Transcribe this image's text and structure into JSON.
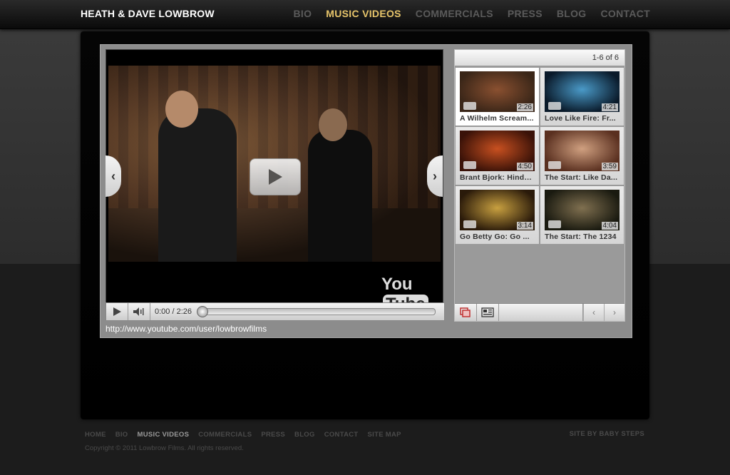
{
  "header": {
    "brand": "HEATH & DAVE LOWBROW",
    "nav": [
      {
        "label": "BIO",
        "active": false
      },
      {
        "label": "MUSIC VIDEOS",
        "active": true
      },
      {
        "label": "COMMERCIALS",
        "active": false
      },
      {
        "label": "PRESS",
        "active": false
      },
      {
        "label": "BLOG",
        "active": false
      },
      {
        "label": "CONTACT",
        "active": false
      }
    ]
  },
  "player": {
    "logo_you": "You",
    "logo_tube": "Tube",
    "time": "0:00 / 2:26",
    "progress": 0,
    "channel_url": "http://www.youtube.com/user/lowbrowfilms",
    "icons": [
      "play-icon",
      "volume-icon",
      "chevron-left-icon",
      "chevron-right-icon"
    ]
  },
  "playlist": {
    "count": "1-6 of 6",
    "items": [
      {
        "title": "A Wilhelm Scream...",
        "duration": "2:26",
        "selected": true,
        "colors": [
          "#3a2618",
          "#8a5030"
        ]
      },
      {
        "title": "Love Like Fire: Fr...",
        "duration": "4:21",
        "selected": false,
        "colors": [
          "#0a1a2a",
          "#4a9ac8"
        ]
      },
      {
        "title": "Brant Bjork: Hinda...",
        "duration": "4:50",
        "selected": false,
        "colors": [
          "#3a1208",
          "#c85020"
        ]
      },
      {
        "title": "The Start: Like Da...",
        "duration": "3:59",
        "selected": false,
        "colors": [
          "#5a3020",
          "#d0a080"
        ]
      },
      {
        "title": "Go Betty Go: Go ...",
        "duration": "3:14",
        "selected": false,
        "colors": [
          "#2a1a0a",
          "#c8a040"
        ]
      },
      {
        "title": "The Start: The 1234",
        "duration": "4:04",
        "selected": false,
        "colors": [
          "#1a1a10",
          "#807050"
        ]
      }
    ],
    "footer_icons": [
      "playlist-icon",
      "grid-view-icon",
      "chevron-left-icon",
      "chevron-right-icon"
    ]
  },
  "footer": {
    "links": [
      {
        "label": "HOME",
        "active": false
      },
      {
        "label": "BIO",
        "active": false
      },
      {
        "label": "MUSIC VIDEOS",
        "active": true
      },
      {
        "label": "COMMERCIALS",
        "active": false
      },
      {
        "label": "PRESS",
        "active": false
      },
      {
        "label": "BLOG",
        "active": false
      },
      {
        "label": "CONTACT",
        "active": false
      },
      {
        "label": "SITE MAP",
        "active": false
      }
    ],
    "credit": "SITE BY BABY STEPS",
    "copyright": "Copyright © 2011 Lowbrow Films. All rights reserved."
  },
  "colors": {
    "accent": "#e6c46a",
    "nav_inactive": "#5a5a5a"
  }
}
